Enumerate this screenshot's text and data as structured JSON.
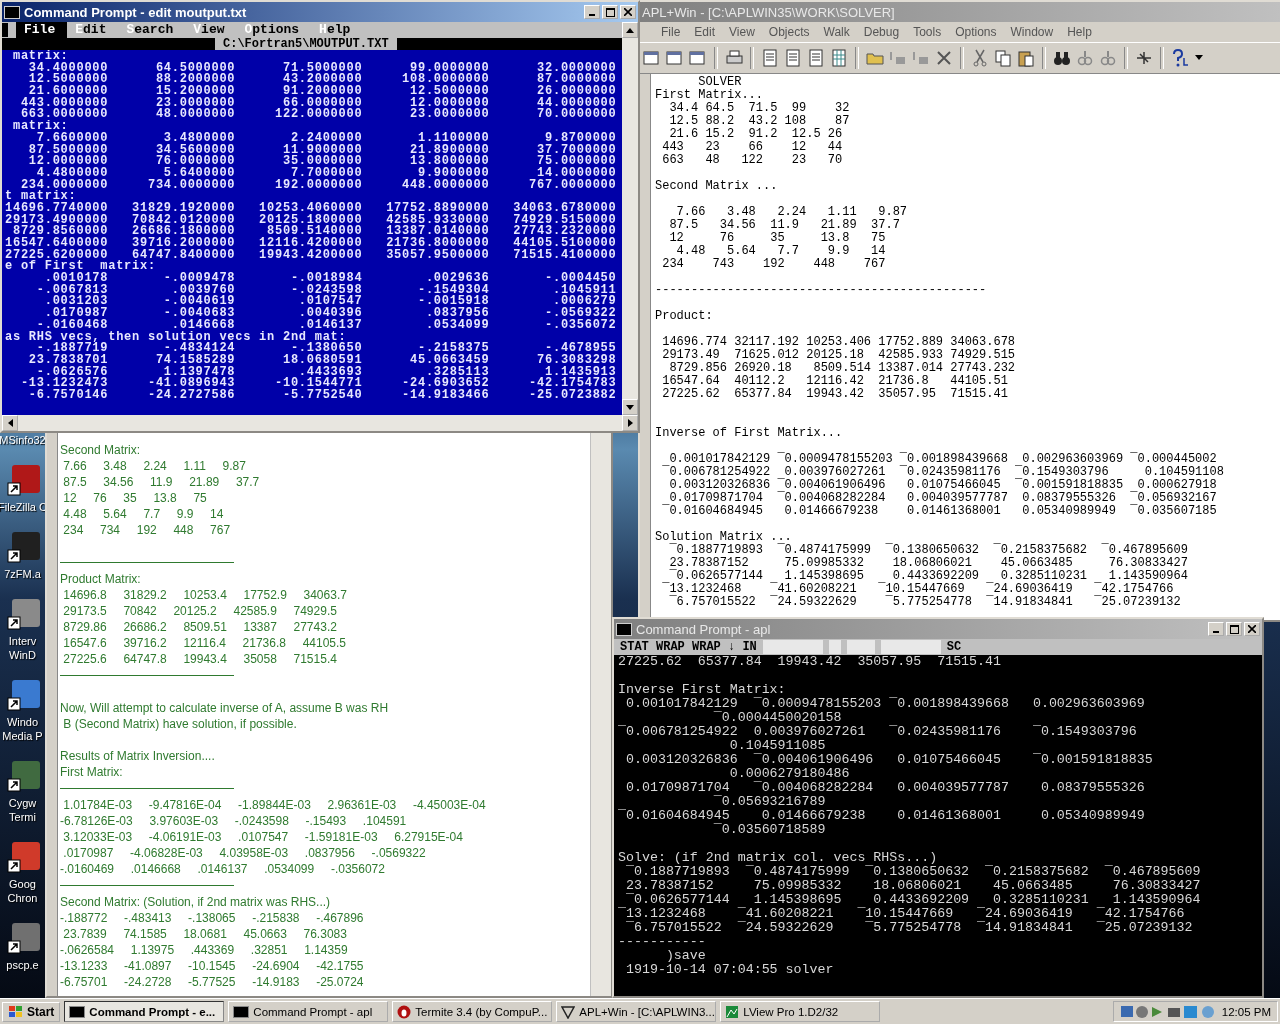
{
  "desktop_icons": [
    {
      "kind": "label_only",
      "label": [
        "MSinfo32"
      ]
    },
    {
      "kind": "icon",
      "label": [
        "FileZilla C"
      ],
      "color": "#b01818"
    },
    {
      "kind": "icon",
      "label": [
        "7zFM.a"
      ],
      "color": "#202020"
    },
    {
      "kind": "icon",
      "label": [
        "Interv",
        "WinD"
      ],
      "color": "#8a8a8a"
    },
    {
      "kind": "icon",
      "label": [
        "Windo",
        "Media P"
      ],
      "color": "#3a7ad0"
    },
    {
      "kind": "icon",
      "label": [
        "Cygw",
        "Termi"
      ],
      "color": "#406a40"
    },
    {
      "kind": "icon",
      "label": [
        "Goog",
        "Chron"
      ],
      "color": "#d03a2a"
    },
    {
      "kind": "icon",
      "label": [
        "pscp.e"
      ],
      "color": "#707070"
    }
  ],
  "apl_window": {
    "title": "APL+Win - [C:\\APLWIN35\\WORK\\SOLVER]",
    "menu": [
      "File",
      "Edit",
      "View",
      "Objects",
      "Walk",
      "Debug",
      "Tools",
      "Options",
      "Window",
      "Help"
    ],
    "lines": [
      {
        "kind": "text",
        "text": "      SOLVER"
      },
      {
        "kind": "text",
        "text": "First Matrix..."
      },
      {
        "kind": "text",
        "text": "  34.4 64.5  71.5  99    32"
      },
      {
        "kind": "text",
        "text": "  12.5 88.2  43.2 108    87"
      },
      {
        "kind": "text",
        "text": "  21.6 15.2  91.2  12.5 26"
      },
      {
        "kind": "text",
        "text": " 443   23    66    12   44"
      },
      {
        "kind": "text",
        "text": " 663   48   122    23   70"
      },
      {
        "kind": "blank"
      },
      {
        "kind": "text",
        "text": "Second Matrix ..."
      },
      {
        "kind": "blank"
      },
      {
        "kind": "text",
        "text": "   7.66   3.48   2.24   1.11   9.87"
      },
      {
        "kind": "text",
        "text": "  87.5   34.56  11.9   21.89  37.7"
      },
      {
        "kind": "text",
        "text": "  12     76     35     13.8   75"
      },
      {
        "kind": "text",
        "text": "   4.48   5.64   7.7    9.9   14"
      },
      {
        "kind": "text",
        "text": " 234    743    192    448    767"
      },
      {
        "kind": "blank"
      },
      {
        "kind": "text",
        "text": "----------------------------------------------"
      },
      {
        "kind": "blank"
      },
      {
        "kind": "text",
        "text": "Product:"
      },
      {
        "kind": "blank"
      },
      {
        "kind": "text",
        "text": " 14696.774 32117.192 10253.406 17752.889 34063.678"
      },
      {
        "kind": "text",
        "text": " 29173.49  71625.012 20125.18  42585.933 74929.515"
      },
      {
        "kind": "text",
        "text": "  8729.856 26920.18   8509.514 13387.014 27743.232"
      },
      {
        "kind": "text",
        "text": " 16547.64  40112.2   12116.42  21736.8   44105.51"
      },
      {
        "kind": "text",
        "text": " 27225.62  65377.84  19943.42  35057.95  71515.41"
      },
      {
        "kind": "blank"
      },
      {
        "kind": "blank"
      },
      {
        "kind": "text",
        "text": "Inverse of First Matrix..."
      },
      {
        "kind": "blank"
      },
      {
        "kind": "text",
        "text": "  0.001017842129 ¯0.0009478155203 ¯0.001898439668  0.002963603969 ¯0.000445002"
      },
      {
        "kind": "text",
        "text": " ¯0.006781254922  0.003976027261  ¯0.02435981176  ¯0.1549303796     0.104591108"
      },
      {
        "kind": "text",
        "text": "  0.003120326836 ¯0.004061906496   0.01075466045  ¯0.001591818835  0.000627918"
      },
      {
        "kind": "text",
        "text": "  0.01709871704  ¯0.004068282284   0.004039577787  0.08379555326  ¯0.056932167"
      },
      {
        "kind": "text",
        "text": " ¯0.01604684945   0.01466679238    0.01461368001   0.05340989949  ¯0.035607185"
      },
      {
        "kind": "blank"
      },
      {
        "kind": "text",
        "text": "Solution Matrix ..."
      },
      {
        "kind": "text",
        "text": "  ¯0.1887719893  ¯0.4874175999  ¯0.1380650632  ¯0.2158375682  ¯0.467895609"
      },
      {
        "kind": "text",
        "text": "  23.78387152     75.09985332    18.06806021    45.0663485     76.30833427"
      },
      {
        "kind": "text",
        "text": "  ¯0.0626577144   1.145398695    0.4433692209   0.3285110231   1.143590964"
      },
      {
        "kind": "text",
        "text": " ¯13.1232468    ¯41.60208221   ¯10.15447669   ¯24.69036419   ¯42.1754766"
      },
      {
        "kind": "text",
        "text": "  ¯6.757015522  ¯24.59322629    ¯5.775254778  ¯14.91834841   ¯25.07239132"
      }
    ]
  },
  "output_window": {
    "lines": [
      {
        "kind": "text",
        "text": "Second Matrix:"
      },
      {
        "kind": "text",
        "text": " 7.66     3.48     2.24     1.11     9.87"
      },
      {
        "kind": "text",
        "text": " 87.5     34.56     11.9     21.89     37.7"
      },
      {
        "kind": "text",
        "text": " 12     76     35     13.8     75"
      },
      {
        "kind": "text",
        "text": " 4.48     5.64     7.7     9.9     14"
      },
      {
        "kind": "text",
        "text": " 234     734     192     448     767"
      },
      {
        "kind": "blank"
      },
      {
        "kind": "rule"
      },
      {
        "kind": "text",
        "text": "Product Matrix:"
      },
      {
        "kind": "text",
        "text": " 14696.8     31829.2     10253.4     17752.9     34063.7"
      },
      {
        "kind": "text",
        "text": " 29173.5     70842     20125.2     42585.9     74929.5"
      },
      {
        "kind": "text",
        "text": " 8729.86     26686.2     8509.51     13387     27743.2"
      },
      {
        "kind": "text",
        "text": " 16547.6     39716.2     12116.4     21736.8     44105.5"
      },
      {
        "kind": "text",
        "text": " 27225.6     64747.8     19943.4     35058     71515.4"
      },
      {
        "kind": "rule"
      },
      {
        "kind": "blank"
      },
      {
        "kind": "text",
        "text": "Now, Will attempt to calculate inverse of A, assume B was RH"
      },
      {
        "kind": "text",
        "text": " B (Second Matrix) have solution, if possible."
      },
      {
        "kind": "blank"
      },
      {
        "kind": "text",
        "text": "Results of Matrix Inversion...."
      },
      {
        "kind": "text",
        "text": "First Matrix:"
      },
      {
        "kind": "rule"
      },
      {
        "kind": "text",
        "text": " 1.01784E-03     -9.47816E-04     -1.89844E-03     2.96361E-03     -4.45003E-04"
      },
      {
        "kind": "text",
        "text": "-6.78126E-03     3.97603E-03     -.0243598     -.15493     .104591"
      },
      {
        "kind": "text",
        "text": " 3.12033E-03     -4.06191E-03     .0107547     -1.59181E-03     6.27915E-04"
      },
      {
        "kind": "text",
        "text": " .0170987     -4.06828E-03     4.03958E-03     .0837956     -.0569322"
      },
      {
        "kind": "text",
        "text": "-.0160469     .0146668     .0146137     .0534099     -.0356072"
      },
      {
        "kind": "rule"
      },
      {
        "kind": "text",
        "text": "Second Matrix: (Solution, if 2nd matrix was RHS...)"
      },
      {
        "kind": "text",
        "text": "-.188772     -.483413     -.138065     -.215838     -.467896"
      },
      {
        "kind": "text",
        "text": " 23.7839     74.1585     18.0681     45.0663     76.3083"
      },
      {
        "kind": "text",
        "text": "-.0626584     1.13975     .443369     .32851     1.14359"
      },
      {
        "kind": "text",
        "text": "-13.1233     -41.0897     -10.1545     -24.6904     -42.1755"
      },
      {
        "kind": "text",
        "text": "-6.75701     -24.2728     -5.77525     -14.9183     -25.0724"
      }
    ]
  },
  "edit_window": {
    "title": "Command Prompt - edit moutput.txt",
    "menu": [
      {
        "label": "File",
        "selected": true
      },
      {
        "label": "Edit",
        "selected": false
      },
      {
        "label": "Search",
        "selected": false
      },
      {
        "label": "View",
        "selected": false
      },
      {
        "label": "Options",
        "selected": false
      },
      {
        "label": "Help",
        "selected": false
      }
    ],
    "file_path": "C:\\Fortran5\\MOUTPUT.TXT",
    "lines": [
      " matrix:",
      "   34.4000000      64.5000000      71.5000000      99.0000000      32.0000000",
      "   12.5000000      88.2000000      43.2000000     108.0000000      87.0000000",
      "   21.6000000      15.2000000      91.2000000      12.5000000      26.0000000",
      "  443.0000000      23.0000000      66.0000000      12.0000000      44.0000000",
      "  663.0000000      48.0000000     122.0000000      23.0000000      70.0000000",
      " matrix:",
      "    7.6600000       3.4800000       2.2400000       1.1100000       9.8700000",
      "   87.5000000      34.5600000      11.9000000      21.8900000      37.7000000",
      "   12.0000000      76.0000000      35.0000000      13.8000000      75.0000000",
      "    4.4800000       5.6400000       7.7000000       9.9000000      14.0000000",
      "  234.0000000     734.0000000     192.0000000     448.0000000     767.0000000",
      "t matrix:",
      "14696.7740000   31829.1920000   10253.4060000   17752.8890000   34063.6780000",
      "29173.4900000   70842.0120000   20125.1800000   42585.9330000   74929.5150000",
      " 8729.8560000   26686.1800000    8509.5140000   13387.0140000   27743.2320000",
      "16547.6400000   39716.2000000   12116.4200000   21736.8000000   44105.5100000",
      "27225.6200000   64747.8400000   19943.4200000   35057.9500000   71515.4100000",
      "e of First  matrix:",
      "     .0010178       -.0009478       -.0018984        .0029636       -.0004450",
      "    -.0067813        .0039760       -.0243598       -.1549304        .1045911",
      "     .0031203       -.0040619        .0107547       -.0015918        .0006279",
      "     .0170987       -.0040683        .0040396        .0837956       -.0569322",
      "    -.0160468        .0146668        .0146137        .0534099       -.0356072",
      "as RHS vecs, then solution vecs in 2nd mat:",
      "    -.1887719       -.4834124       -.1380650       -.2158375       -.4678955",
      "   23.7838701      74.1585289      18.0680591      45.0663459      76.3083298",
      "    -.0626576       1.1397478        .4433693        .3285113       1.1435913",
      "  -13.1232473     -41.0896943     -10.1544771     -24.6903652     -42.1754783",
      "   -6.7570146     -24.2727586      -5.7752540     -14.9183466     -25.0723882"
    ]
  },
  "apl_console": {
    "title": "Command Prompt - apl",
    "status_left": "STAT WRAP WRAP ↓ IN",
    "status_right": "SC",
    "lines": [
      {
        "kind": "text",
        "text": "27225.62  65377.84  19943.42  35057.95  71515.41"
      },
      {
        "kind": "blank"
      },
      {
        "kind": "text",
        "text": "Inverse First Matrix:"
      },
      {
        "kind": "text",
        "text": " 0.001017842129  ¯0.0009478155203 ¯0.001898439668   0.002963603969"
      },
      {
        "kind": "text",
        "text": "            ¯0.0004450020158"
      },
      {
        "kind": "text",
        "text": "¯0.006781254922  0.003976027261   ¯0.02435981176    ¯0.1549303796"
      },
      {
        "kind": "text",
        "text": "              0.1045911085"
      },
      {
        "kind": "text",
        "text": " 0.003120326836  ¯0.004061906496   0.01075466045    ¯0.001591818835"
      },
      {
        "kind": "text",
        "text": "              0.0006279180486"
      },
      {
        "kind": "text",
        "text": " 0.01709871704   ¯0.004068282284   0.004039577787    0.08379555326"
      },
      {
        "kind": "text",
        "text": "            ¯0.05693216789"
      },
      {
        "kind": "text",
        "text": "¯0.01604684945    0.01466679238    0.01461368001     0.05340989949"
      },
      {
        "kind": "text",
        "text": "            ¯0.03560718589"
      },
      {
        "kind": "blank"
      },
      {
        "kind": "text",
        "text": "Solve: (if 2nd matrix col. vecs RHSs...)"
      },
      {
        "kind": "text",
        "text": " ¯0.1887719893  ¯0.4874175999  ¯0.1380650632  ¯0.2158375682  ¯0.467895609"
      },
      {
        "kind": "text",
        "text": " 23.78387152     75.09985332    18.06806021    45.0663485     76.30833427"
      },
      {
        "kind": "text",
        "text": " ¯0.0626577144   1.145398695    0.4433692209   0.3285110231   1.143590964"
      },
      {
        "kind": "text",
        "text": "¯13.1232468    ¯41.60208221   ¯10.15447669   ¯24.69036419   ¯42.1754766"
      },
      {
        "kind": "text",
        "text": " ¯6.757015522  ¯24.59322629    ¯5.775254778  ¯14.91834841   ¯25.07239132"
      },
      {
        "kind": "text",
        "text": "-----------"
      },
      {
        "kind": "text",
        "text": "      )save"
      },
      {
        "kind": "text",
        "text": " 1919-10-14 07:04:55 solver"
      }
    ]
  },
  "taskbar": {
    "start": "Start",
    "buttons": [
      {
        "label": "Command Prompt - e...",
        "kind": "cmd",
        "selected": true
      },
      {
        "label": "Command Prompt - apl",
        "kind": "cmd",
        "selected": false
      },
      {
        "label": "Termite 3.4 (by CompuP...",
        "kind": "termite",
        "selected": false
      },
      {
        "label": "APL+Win - [C:\\APLWIN3...",
        "kind": "apl",
        "selected": false
      },
      {
        "label": "LView Pro 1.D2/32",
        "kind": "lview",
        "selected": false
      }
    ],
    "clock": "12:05 PM"
  }
}
